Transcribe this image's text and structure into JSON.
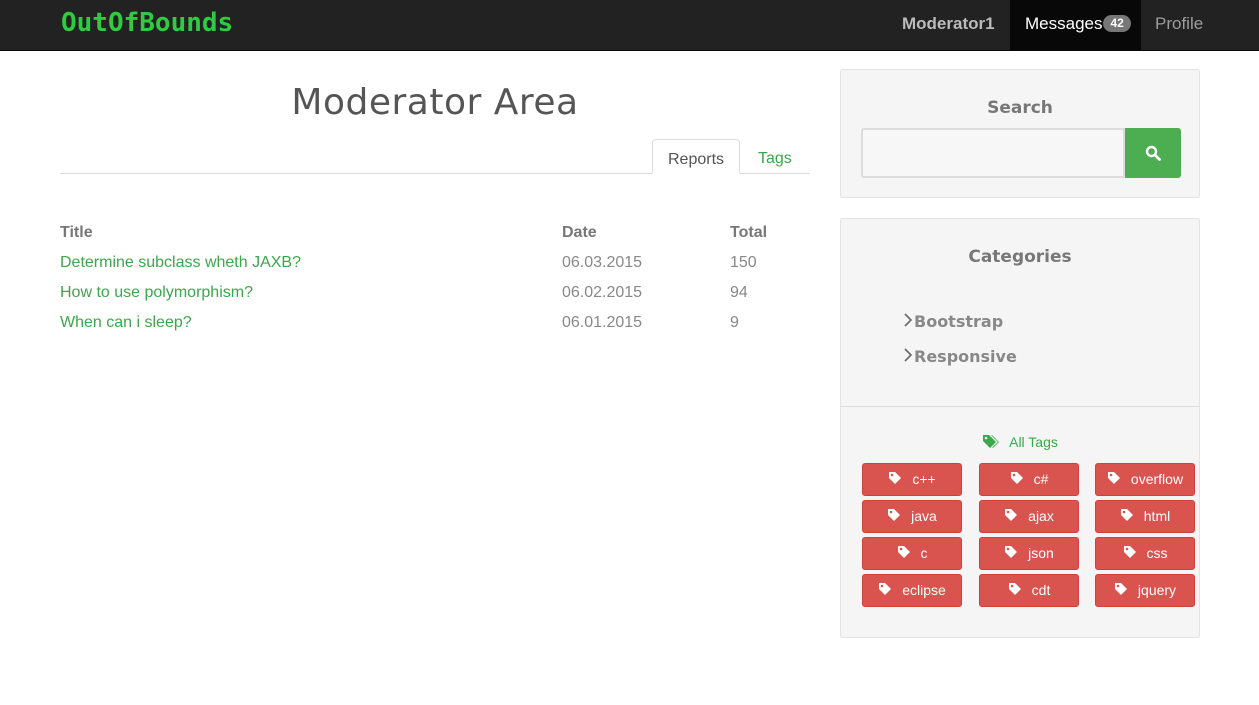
{
  "navbar": {
    "brand": "OutOfBounds",
    "user": "Moderator1",
    "messages_label": "Messages",
    "messages_count": "42",
    "profile_label": "Profile"
  },
  "main": {
    "title": "Moderator Area",
    "tabs": [
      {
        "label": "Reports",
        "active": true
      },
      {
        "label": "Tags",
        "active": false
      }
    ],
    "table": {
      "headers": [
        "Title",
        "Date",
        "Total"
      ],
      "rows": [
        {
          "title": "Determine subclass wheth JAXB?",
          "date": "06.03.2015",
          "total": "150"
        },
        {
          "title": "How to use polymorphism?",
          "date": "06.02.2015",
          "total": "94"
        },
        {
          "title": "When can i sleep?",
          "date": "06.01.2015",
          "total": "9"
        }
      ]
    }
  },
  "sidebar": {
    "search": {
      "title": "Search",
      "placeholder": "",
      "value": "",
      "button_icon": "search-icon"
    },
    "categories": {
      "title": "Categories",
      "items": [
        "Bootstrap",
        "Responsive"
      ],
      "all_tags_label": "All Tags",
      "tags": [
        "c++",
        "c#",
        "overflow",
        "java",
        "ajax",
        "html",
        "c",
        "json",
        "css",
        "eclipse",
        "cdt",
        "jquery"
      ]
    }
  },
  "colors": {
    "brand": "#2ecc40",
    "link": "#3aa84b",
    "navbar_bg": "#222222",
    "tag_bg": "#d9534f",
    "search_button": "#4cae50"
  }
}
